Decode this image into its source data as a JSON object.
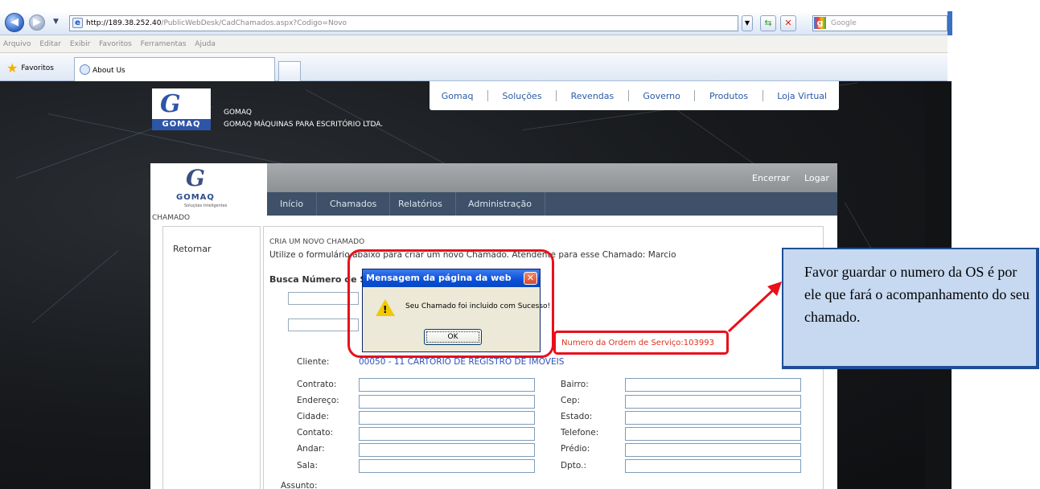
{
  "browser": {
    "url": "http://189.38.252.40/PublicWebDesk/CadChamados.aspx?Codigo=Novo",
    "url_host": "http://189.38.252.40",
    "url_path": "/PublicWebDesk/CadChamados.aspx?Codigo=Novo",
    "search_placeholder": "Google",
    "menu": [
      "Arquivo",
      "Editar",
      "Exibir",
      "Favoritos",
      "Ferramentas",
      "Ajuda"
    ],
    "favorites_label": "Favoritos",
    "tab_title": "About Us"
  },
  "site": {
    "company_short": "GOMAQ",
    "company_full": "GOMAQ MÁQUINAS PARA ESCRITÓRIO LTDA.",
    "logo_text": "GOMAQ",
    "topnav": [
      "Gomaq",
      "Soluções",
      "Revendas",
      "Governo",
      "Produtos",
      "Loja Virtual"
    ]
  },
  "app": {
    "logo_text": "GOMAQ",
    "logo_subtitle": "Soluções Inteligentes",
    "section_label": "CHAMADO",
    "top_links": {
      "encerrar": "Encerrar",
      "logar": "Logar"
    },
    "menu": [
      "Início",
      "Chamados",
      "Relatórios",
      "Administração"
    ],
    "sidebar": {
      "return_link": "Retornar"
    },
    "form": {
      "title": "CRIA UM NOVO CHAMADO",
      "description": "Utilize o formulário abaixo para criar um novo Chamado. Atendente para esse Chamado: Marcio",
      "search_label": "Busca Número de S",
      "os_number": "Numero da Ordem de Serviço:103993",
      "cliente_label": "Cliente:",
      "cliente_value": "00050 - 11 CARTORIO DE REGISTRO DE IMOVEIS",
      "left_fields": [
        "Contrato:",
        "Endereço:",
        "Cidade:",
        "Contato:",
        "Andar:",
        "Sala:"
      ],
      "right_fields": [
        "Bairro:",
        "Cep:",
        "Estado:",
        "Telefone:",
        "Prédio:",
        "Dpto.:"
      ],
      "assunto_label": "Assunto:"
    }
  },
  "dialog": {
    "title": "Mensagem da página da web",
    "message": "Seu Chamado foi incluido com Sucesso!",
    "ok_label": "OK"
  },
  "annotation": {
    "callout_text": "Favor guardar o numero da OS é por ele que fará o acompanhamento do seu chamado.",
    "highlight_color": "#e8101a",
    "callout_bg": "#c6d9f1"
  }
}
